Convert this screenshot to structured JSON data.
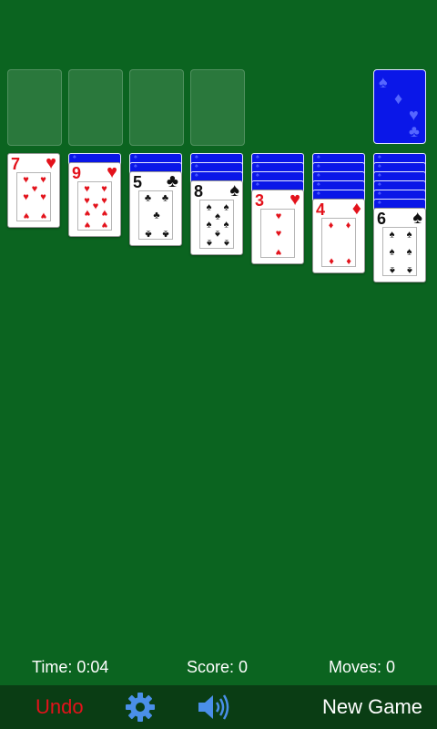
{
  "game": {
    "foundations": [
      {
        "name": "foundation-1"
      },
      {
        "name": "foundation-2"
      },
      {
        "name": "foundation-3"
      },
      {
        "name": "foundation-4"
      }
    ],
    "stock": {
      "face": "down"
    },
    "tableau": [
      {
        "hidden": 0,
        "top": {
          "rank": "7",
          "suit": "♥",
          "color": "red",
          "count": 7
        }
      },
      {
        "hidden": 1,
        "top": {
          "rank": "9",
          "suit": "♥",
          "color": "red",
          "count": 9
        }
      },
      {
        "hidden": 2,
        "top": {
          "rank": "5",
          "suit": "♣",
          "color": "black",
          "count": 5
        }
      },
      {
        "hidden": 3,
        "top": {
          "rank": "8",
          "suit": "♠",
          "color": "black",
          "count": 8
        }
      },
      {
        "hidden": 4,
        "top": {
          "rank": "3",
          "suit": "♥",
          "color": "red",
          "count": 3
        }
      },
      {
        "hidden": 5,
        "top": {
          "rank": "4",
          "suit": "♦",
          "color": "red",
          "count": 4
        }
      },
      {
        "hidden": 6,
        "top": {
          "rank": "6",
          "suit": "♠",
          "color": "black",
          "count": 6
        }
      }
    ]
  },
  "status": {
    "time": "Time: 0:04",
    "score": "Score: 0",
    "moves": "Moves: 0"
  },
  "toolbar": {
    "undo_label": "Undo",
    "new_game_label": "New Game",
    "settings_icon": "gear-icon",
    "sound_icon": "speaker-icon"
  },
  "colors": {
    "felt": "#0b6420",
    "toolbar": "#0a3d14",
    "card_back": "#0a17e8",
    "red_suit": "#e3121b",
    "undo": "#e3121b",
    "icon_blue": "#4a8fe8"
  }
}
